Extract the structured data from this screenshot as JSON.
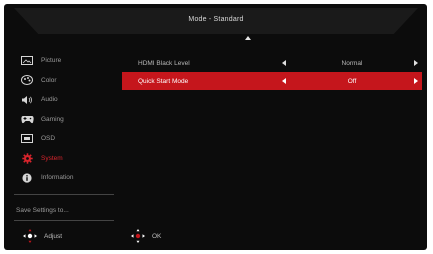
{
  "header": {
    "title": "Mode - Standard"
  },
  "sidebar": {
    "items": [
      {
        "label": "Picture",
        "icon": "picture-icon",
        "active": false
      },
      {
        "label": "Color",
        "icon": "color-icon",
        "active": false
      },
      {
        "label": "Audio",
        "icon": "audio-icon",
        "active": false
      },
      {
        "label": "Gaming",
        "icon": "gaming-icon",
        "active": false
      },
      {
        "label": "OSD",
        "icon": "osd-icon",
        "active": false
      },
      {
        "label": "System",
        "icon": "system-gear-icon",
        "active": true
      },
      {
        "label": "Information",
        "icon": "info-icon",
        "active": false
      }
    ],
    "save_settings": "Save Settings to..."
  },
  "settings": {
    "rows": [
      {
        "label": "HDMI Black Level",
        "value": "Normal",
        "highlighted": false
      },
      {
        "label": "Quick Start Mode",
        "value": "Off",
        "highlighted": true
      }
    ]
  },
  "footer": {
    "adjust": {
      "label": "Adjust",
      "icon": "dpad-left-right-icon"
    },
    "ok": {
      "label": "OK",
      "icon": "dpad-center-icon"
    }
  },
  "colors": {
    "background": "#0c0c0c",
    "accent": "#c5161c",
    "active_text": "#d8242c"
  }
}
